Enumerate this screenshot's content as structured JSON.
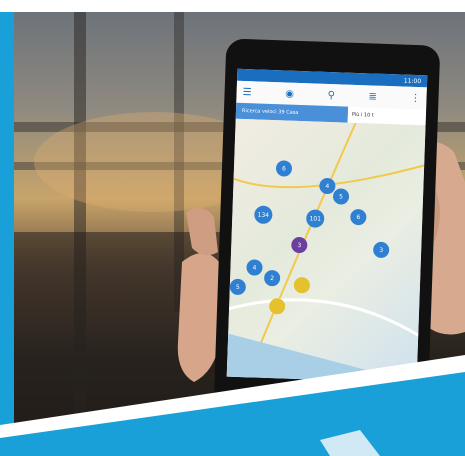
{
  "phone": {
    "status_time": "11:00",
    "banner_button": "Ricerca veloci 39 Casa",
    "banner_select": "Più i 10 t",
    "map_pins": [
      "6",
      "4",
      "5",
      "134",
      "101",
      "6",
      "3",
      "3",
      "4",
      "5",
      "2"
    ]
  },
  "colors": {
    "accent": "#1aa0d8",
    "appbar": "#1a6ec0",
    "pin_blue": "#2f7fd3",
    "pin_purple": "#6a3fa0",
    "pin_yellow": "#e5c12e"
  }
}
